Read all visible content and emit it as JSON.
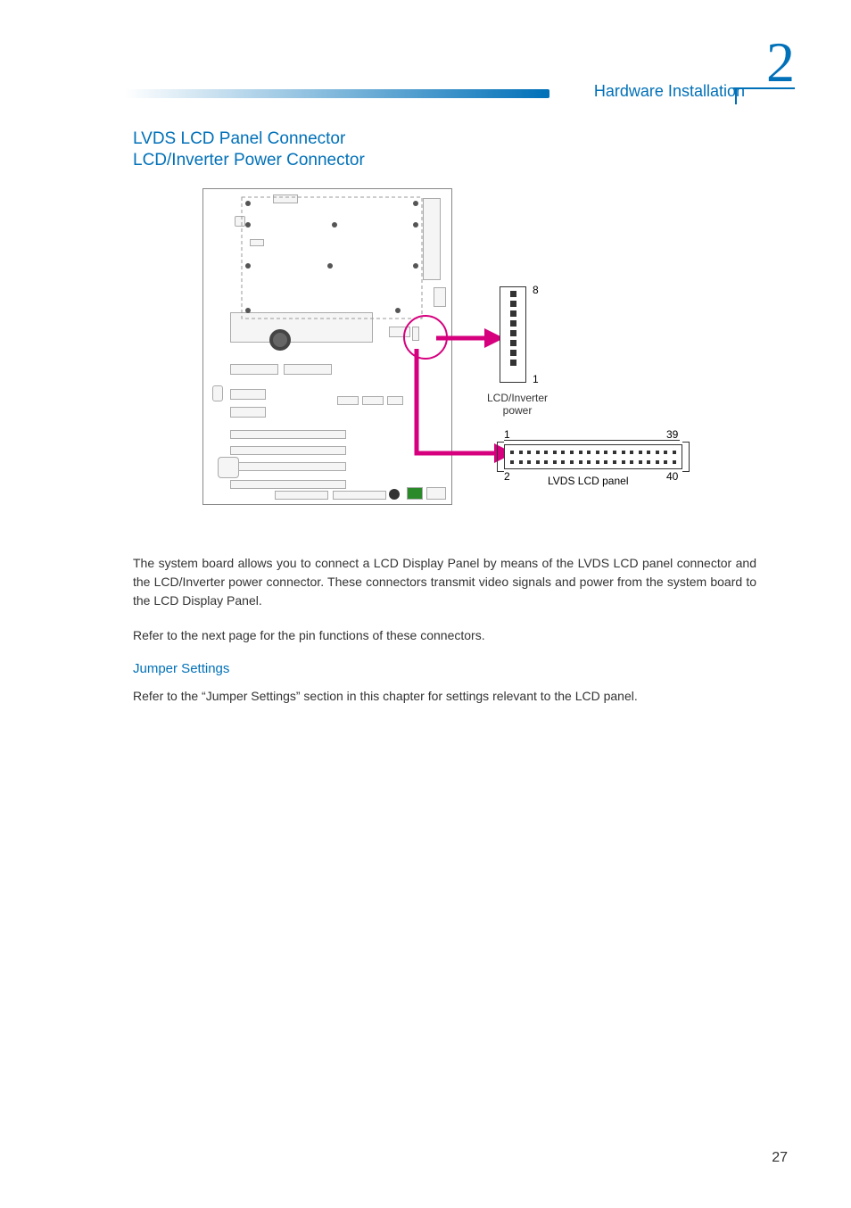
{
  "header": {
    "chapter_number": "2",
    "chapter_title": "Hardware Installation"
  },
  "titles": {
    "line1": "LVDS LCD Panel Connector",
    "line2": "LCD/Inverter Power Connector"
  },
  "diagram": {
    "lcd_inverter": {
      "label_line1": "LCD/Inverter",
      "label_line2": "power",
      "pin_high": "8",
      "pin_low": "1"
    },
    "lvds": {
      "pin_tl": "1",
      "pin_tr": "39",
      "pin_bl": "2",
      "pin_br": "40",
      "label": "LVDS LCD panel"
    }
  },
  "paragraphs": {
    "p1": "The system board allows you to connect a LCD Display Panel by means of the LVDS LCD panel connector and the LCD/Inverter power connector. These connectors transmit video signals and power from the system board to the LCD Display Panel.",
    "p2": "Refer to the next page for the pin functions of these connectors.",
    "p3": "Refer to the “Jumper Settings” section in this chapter for settings relevant to the LCD panel."
  },
  "subsection": {
    "title": "Jumper Settings"
  },
  "page_number": "27"
}
